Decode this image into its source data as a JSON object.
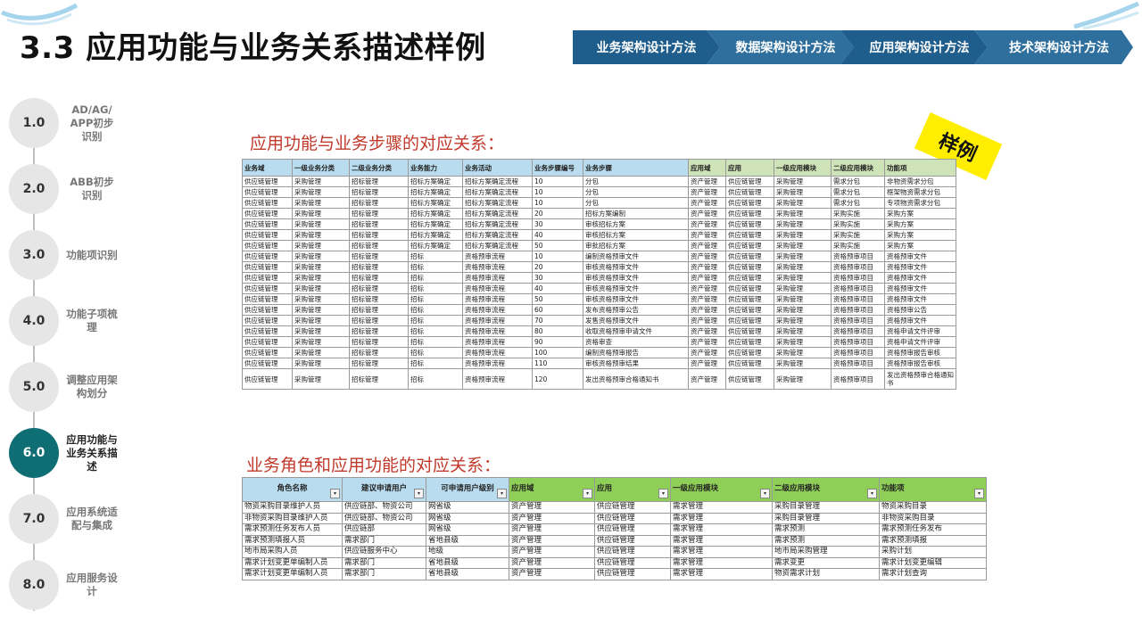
{
  "header": {
    "title": "3.3 应用功能与业务关系描述样例"
  },
  "nav": [
    {
      "label": "业务架构设计方法",
      "color": "#1f5d8c"
    },
    {
      "label": "数据架构设计方法",
      "color": "#2f6f9e"
    },
    {
      "label": "应用架构设计方法",
      "color": "#1f5d8c"
    },
    {
      "label": "技术架构设计方法",
      "color": "#2f6f9e"
    }
  ],
  "timeline": [
    {
      "num": "1.0",
      "label": "AD/AG/ APP初步识别",
      "active": false
    },
    {
      "num": "2.0",
      "label": "ABB初步识别",
      "active": false
    },
    {
      "num": "3.0",
      "label": "功能项识别",
      "active": false
    },
    {
      "num": "4.0",
      "label": "功能子项梳理",
      "active": false
    },
    {
      "num": "5.0",
      "label": "调整应用架构划分",
      "active": false
    },
    {
      "num": "6.0",
      "label": "应用功能与业务关系描述",
      "active": true
    },
    {
      "num": "7.0",
      "label": "应用系统适配与集成",
      "active": false
    },
    {
      "num": "8.0",
      "label": "应用服务设计",
      "active": false
    }
  ],
  "badge": "样例",
  "section1": {
    "title": "应用功能与业务步骤的对应关系：",
    "headers": [
      "业务域",
      "一级业务分类",
      "二级业务分类",
      "业务能力",
      "业务活动",
      "业务步骤编号",
      "业务步骤",
      "应用域",
      "应用",
      "一级应用模块",
      "二级应用模块",
      "功能项"
    ],
    "rows": [
      [
        "供应链管理",
        "采购管理",
        "招标管理",
        "招标方案确定",
        "招标方案确定流程",
        "10",
        "分包",
        "资产管理",
        "供应链管理",
        "采购管理",
        "需求分包",
        "非物资需求分包"
      ],
      [
        "供应链管理",
        "采购管理",
        "招标管理",
        "招标方案确定",
        "招标方案确定流程",
        "10",
        "分包",
        "资产管理",
        "供应链管理",
        "采购管理",
        "需求分包",
        "框架物资需求分包"
      ],
      [
        "供应链管理",
        "采购管理",
        "招标管理",
        "招标方案确定",
        "招标方案确定流程",
        "10",
        "分包",
        "资产管理",
        "供应链管理",
        "采购管理",
        "需求分包",
        "专项物资需求分包"
      ],
      [
        "供应链管理",
        "采购管理",
        "招标管理",
        "招标方案确定",
        "招标方案确定流程",
        "20",
        "招标方案编制",
        "资产管理",
        "供应链管理",
        "采购管理",
        "采购实施",
        "采购方案"
      ],
      [
        "供应链管理",
        "采购管理",
        "招标管理",
        "招标方案确定",
        "招标方案确定流程",
        "30",
        "审核招标方案",
        "资产管理",
        "供应链管理",
        "采购管理",
        "采购实施",
        "采购方案"
      ],
      [
        "供应链管理",
        "采购管理",
        "招标管理",
        "招标方案确定",
        "招标方案确定流程",
        "40",
        "审核招标方案",
        "资产管理",
        "供应链管理",
        "采购管理",
        "采购实施",
        "采购方案"
      ],
      [
        "供应链管理",
        "采购管理",
        "招标管理",
        "招标方案确定",
        "招标方案确定流程",
        "50",
        "审批招标方案",
        "资产管理",
        "供应链管理",
        "采购管理",
        "采购实施",
        "采购方案"
      ],
      [
        "供应链管理",
        "采购管理",
        "招标管理",
        "招标",
        "资格预审流程",
        "10",
        "编制资格预审文件",
        "资产管理",
        "供应链管理",
        "采购管理",
        "资格预审项目",
        "资格预审文件"
      ],
      [
        "供应链管理",
        "采购管理",
        "招标管理",
        "招标",
        "资格预审流程",
        "20",
        "审核资格预审文件",
        "资产管理",
        "供应链管理",
        "采购管理",
        "资格预审项目",
        "资格预审文件"
      ],
      [
        "供应链管理",
        "采购管理",
        "招标管理",
        "招标",
        "资格预审流程",
        "30",
        "审核资格预审文件",
        "资产管理",
        "供应链管理",
        "采购管理",
        "资格预审项目",
        "资格预审文件"
      ],
      [
        "供应链管理",
        "采购管理",
        "招标管理",
        "招标",
        "资格预审流程",
        "40",
        "审核资格预审文件",
        "资产管理",
        "供应链管理",
        "采购管理",
        "资格预审项目",
        "资格预审文件"
      ],
      [
        "供应链管理",
        "采购管理",
        "招标管理",
        "招标",
        "资格预审流程",
        "50",
        "审核资格预审文件",
        "资产管理",
        "供应链管理",
        "采购管理",
        "资格预审项目",
        "资格预审文件"
      ],
      [
        "供应链管理",
        "采购管理",
        "招标管理",
        "招标",
        "资格预审流程",
        "60",
        "发布资格预审公告",
        "资产管理",
        "供应链管理",
        "采购管理",
        "资格预审项目",
        "资格预审公告"
      ],
      [
        "供应链管理",
        "采购管理",
        "招标管理",
        "招标",
        "资格预审流程",
        "70",
        "发售资格预审文件",
        "资产管理",
        "供应链管理",
        "采购管理",
        "资格预审项目",
        "资格预审文件"
      ],
      [
        "供应链管理",
        "采购管理",
        "招标管理",
        "招标",
        "资格预审流程",
        "80",
        "收取资格预审申请文件",
        "资产管理",
        "供应链管理",
        "采购管理",
        "资格预审项目",
        "资格申请文件评审"
      ],
      [
        "供应链管理",
        "采购管理",
        "招标管理",
        "招标",
        "资格预审流程",
        "90",
        "资格审查",
        "资产管理",
        "供应链管理",
        "采购管理",
        "资格预审项目",
        "资格申请文件评审"
      ],
      [
        "供应链管理",
        "采购管理",
        "招标管理",
        "招标",
        "资格预审流程",
        "100",
        "编制资格预审报告",
        "资产管理",
        "供应链管理",
        "采购管理",
        "资格预审项目",
        "资格预审报告审核"
      ],
      [
        "供应链管理",
        "采购管理",
        "招标管理",
        "招标",
        "资格预审流程",
        "110",
        "审核资格预审结果",
        "资产管理",
        "供应链管理",
        "采购管理",
        "资格预审项目",
        "资格预审报告审核"
      ],
      [
        "供应链管理",
        "采购管理",
        "招标管理",
        "招标",
        "资格预审流程",
        "120",
        "发出资格预审合格通知书",
        "资产管理",
        "供应链管理",
        "采购管理",
        "资格预审项目",
        "发出资格预审合格通知书"
      ]
    ]
  },
  "section2": {
    "title": "业务角色和应用功能的对应关系：",
    "headers": [
      "角色名称",
      "建议申请用户",
      "可申请用户级别",
      "应用域",
      "应用",
      "一级应用模块",
      "二级应用模块",
      "功能项"
    ],
    "rows": [
      [
        "物资采购目录维护人员",
        "供应链部、物资公司",
        "网省级",
        "资产管理",
        "供应链管理",
        "需求管理",
        "采购目录管理",
        "物资采购目录"
      ],
      [
        "非物资采购目录维护人员",
        "供应链部、物资公司",
        "网省级",
        "资产管理",
        "供应链管理",
        "需求管理",
        "采购目录管理",
        "非物资采购目录"
      ],
      [
        "需求预测任务发布人员",
        "供应链部",
        "网省级",
        "资产管理",
        "供应链管理",
        "需求管理",
        "需求预测",
        "需求预测任务发布"
      ],
      [
        "需求预测填报人员",
        "需求部门",
        "省地县级",
        "资产管理",
        "供应链管理",
        "需求管理",
        "需求预测",
        "需求预测填报"
      ],
      [
        "地市局采购人员",
        "供应链服务中心",
        "地级",
        "资产管理",
        "供应链管理",
        "需求管理",
        "地市局采购管理",
        "采购计划"
      ],
      [
        "需求计划变更单编制人员",
        "需求部门",
        "省地县级",
        "资产管理",
        "供应链管理",
        "需求管理",
        "需求变更",
        "需求计划变更编辑"
      ],
      [
        "需求计划变更单编制人员",
        "需求部门",
        "省地县级",
        "资产管理",
        "供应链管理",
        "需求管理",
        "物资需求计划",
        "需求计划查询"
      ]
    ]
  }
}
